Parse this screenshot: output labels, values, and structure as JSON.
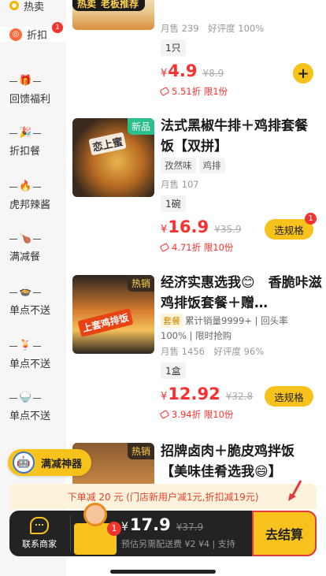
{
  "sidebar": {
    "items": [
      {
        "label": "热卖",
        "icon": "circle-icon"
      },
      {
        "label": "折扣",
        "icon": "discount-icon",
        "badge": "1"
      },
      {
        "label": "回馈福利",
        "icon": "gift-icon"
      },
      {
        "label": "折扣餐",
        "icon": "party-popper-icon"
      },
      {
        "label": "虎邦辣酱",
        "icon": "fire-icon"
      },
      {
        "label": "满减餐",
        "icon": "drumstick-icon"
      },
      {
        "label": "单点不送",
        "icon": "bowl-icon"
      },
      {
        "label": "单点不送",
        "icon": "drink-icon"
      },
      {
        "label": "单点不送",
        "icon": "rice-bowl-icon"
      }
    ]
  },
  "products": [
    {
      "hot_tag": "热卖",
      "boss_tag": "老板推荐",
      "meta": "月售 239　好评度 100%",
      "unit": "1只",
      "price": "4.9",
      "orig_price": "¥8.9",
      "discount": "5.51折 限1份",
      "action": "+"
    },
    {
      "badge": "新品",
      "image_caption": "恋上蜜",
      "title": "法式黑椒牛排＋鸡排套餐饭【双拼】",
      "tags": [
        "孜然味",
        "鸡排"
      ],
      "meta": "月售 107",
      "unit": "1碗",
      "price": "16.9",
      "orig_price": "¥35.9",
      "discount": "4.71折 限10份",
      "action": "选规格",
      "action_badge": "1"
    },
    {
      "badge": "热销",
      "image_caption": "上套鸡排饭",
      "title": "经济实惠选我😊　香脆咔滋鸡排饭套餐＋赠…",
      "tag_yellow": "套餐",
      "line1": "累计销量9999+ | 回头率",
      "line2": "100% | 限时抢购",
      "meta": "月售 1456　好评度 96%",
      "unit": "1盒",
      "price": "12.92",
      "orig_price": "¥32.8",
      "discount": "3.94折 限10份",
      "action": "选规格"
    },
    {
      "badge": "热销",
      "title": "招牌卤肉＋脆皮鸡拌饭【美味佳肴选我😄】"
    }
  ],
  "promo": {
    "label": "满减神器"
  },
  "notice": "下单减 20 元 (门店新用户减1元,折扣减19元)",
  "cart": {
    "contact": "联系商家",
    "count": "1",
    "price": "17.9",
    "orig_price": "¥37.9",
    "sub": "预估另需配送费 ¥2 ¥4 | 支持",
    "checkout": "去结算"
  },
  "colors": {
    "accent": "#f7c21b",
    "price": "#ff2e2e",
    "new_badge": "#2bbf8b",
    "dark": "#232323"
  }
}
